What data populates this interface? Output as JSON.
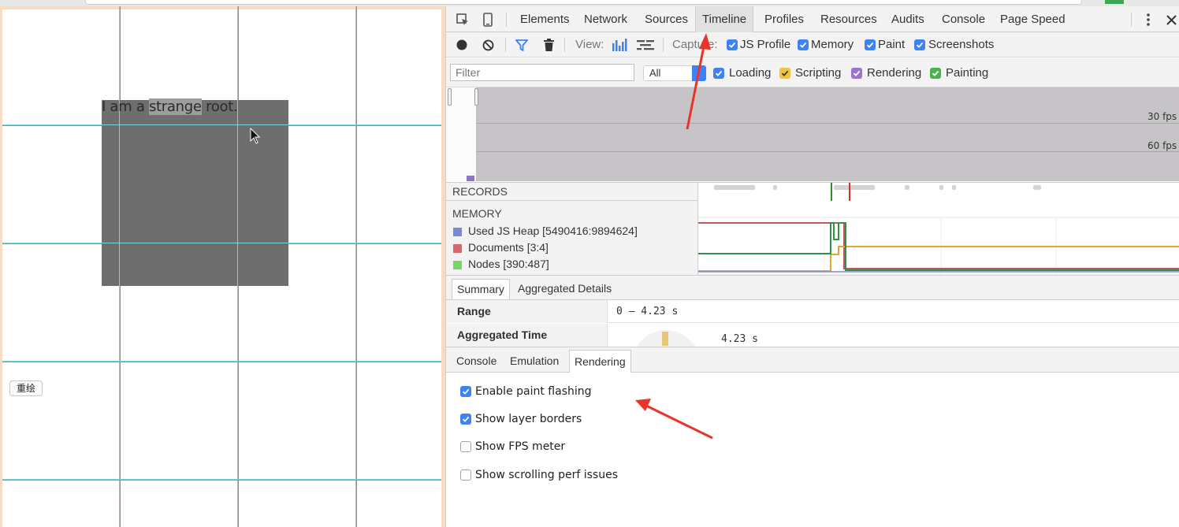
{
  "page": {
    "root_text_prefix": "I am a ",
    "root_text_highlight": "strange",
    "root_text_suffix": " root.",
    "repaint_button": "重绘"
  },
  "devtools": {
    "tabs": [
      "Elements",
      "Network",
      "Sources",
      "Timeline",
      "Profiles",
      "Resources",
      "Audits",
      "Console",
      "Page Speed"
    ],
    "active_tab": "Timeline",
    "toolbar": {
      "view_label": "View:",
      "capture_label": "Capture:",
      "capture_options": [
        {
          "label": "JS Profile",
          "checked": true
        },
        {
          "label": "Memory",
          "checked": true
        },
        {
          "label": "Paint",
          "checked": true
        },
        {
          "label": "Screenshots",
          "checked": true
        }
      ]
    },
    "filter": {
      "placeholder": "Filter",
      "select_value": "All",
      "categories": [
        {
          "label": "Loading",
          "checked": true,
          "color": "#3e82f7"
        },
        {
          "label": "Scripting",
          "checked": true,
          "color": "#f2c43b"
        },
        {
          "label": "Rendering",
          "checked": true,
          "color": "#9b72cf"
        },
        {
          "label": "Painting",
          "checked": true,
          "color": "#4caf50"
        }
      ]
    },
    "overview": {
      "fps_30": "30 fps",
      "fps_60": "60 fps"
    },
    "records_label": "RECORDS",
    "memory": {
      "title": "MEMORY",
      "legend": [
        {
          "label": "Used JS Heap [5490416:9894624]",
          "color": "#7b88d9"
        },
        {
          "label": "Documents [3:4]",
          "color": "#d9676b"
        },
        {
          "label": "Nodes [390:487]",
          "color": "#79d46a"
        }
      ]
    },
    "summary": {
      "tabs": [
        "Summary",
        "Aggregated Details"
      ],
      "active": "Summary",
      "range_label": "Range",
      "range_value": "0 – 4.23 s",
      "aggregated_label": "Aggregated Time",
      "aggregated_value": "4.23 s"
    },
    "drawer": {
      "tabs": [
        "Console",
        "Emulation",
        "Rendering"
      ],
      "active": "Rendering",
      "options": [
        {
          "label": "Enable paint flashing",
          "checked": true
        },
        {
          "label": "Show layer borders",
          "checked": true
        },
        {
          "label": "Show FPS meter",
          "checked": false
        },
        {
          "label": "Show scrolling perf issues",
          "checked": false
        }
      ]
    }
  },
  "colors": {
    "accent": "#3e82f7",
    "annotation_arrow": "#e8342b",
    "layer_border_cyan": "#74d6dd",
    "root_gray": "#6e6e6e"
  }
}
